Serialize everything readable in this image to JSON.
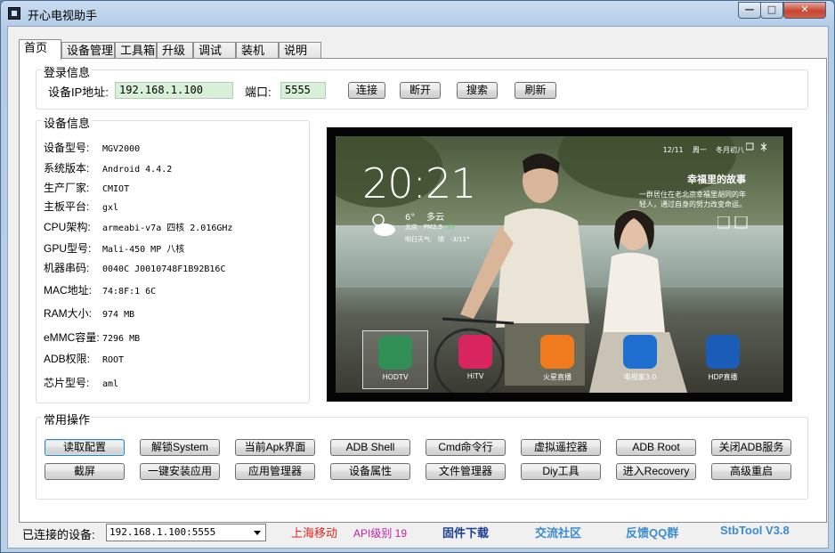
{
  "window": {
    "title": "开心电视助手",
    "controls": {
      "minimize": "—",
      "maximize": "□",
      "close": "✕"
    }
  },
  "tabs": [
    "首页",
    "设备管理",
    "工具箱",
    "升级",
    "调试",
    "装机",
    "说明"
  ],
  "login": {
    "group_label": "登录信息",
    "ip_label": "设备IP地址:",
    "ip_value": "192.168.1.100",
    "port_label": "端口:",
    "port_value": "5555",
    "buttons": [
      "连接",
      "断开",
      "搜索",
      "刷新"
    ]
  },
  "device_info": {
    "group_label": "设备信息",
    "rows": [
      {
        "key": "设备型号:",
        "value": "MGV2000"
      },
      {
        "key": "系统版本:",
        "value": "Android 4.4.2"
      },
      {
        "key": "生产厂家:",
        "value": "CMIOT"
      },
      {
        "key": "主板平台:",
        "value": "gxl"
      },
      {
        "key": "CPU架构:",
        "value": "armeabi-v7a 四核 2.016GHz"
      },
      {
        "key": "GPU型号:",
        "value": "Mali-450 MP 八核"
      },
      {
        "key": "机器串码:",
        "value": "0040C            J0010748F1B92B16C"
      },
      {
        "key": "MAC地址:",
        "value": "74:8F:1        6C"
      },
      {
        "key": "RAM大小:",
        "value": "974 MB"
      },
      {
        "key": "eMMC容量:",
        "value": "7296 MB"
      },
      {
        "key": "ADB权限:",
        "value": "ROOT"
      },
      {
        "key": "芯片型号:",
        "value": "aml"
      }
    ]
  },
  "tv_screen": {
    "top_date": "12/11",
    "top_weekday": "周一",
    "top_lunar": "冬月初八",
    "clock": "20:21",
    "temp": "6°",
    "weather": "多云",
    "city": "北京",
    "pm": "PM2.5",
    "aqi": "59",
    "tomorrow": "明日天气:",
    "tomorrow_weather": "晴",
    "tomorrow_temp": "-3/11°",
    "promo_title": "幸福里的故事",
    "promo_text": "一群居住在老北京幸福里胡同的年轻人，通过自身的努力改变命运。",
    "apps": [
      {
        "name": "HODTV",
        "color": "#2f8f55"
      },
      {
        "name": "HiTV",
        "color": "#d8245f"
      },
      {
        "name": "火星直播",
        "color": "#f07a1e"
      },
      {
        "name": "电视家3.0",
        "color": "#1f6fd0"
      },
      {
        "name": "HDP直播",
        "color": "#1a5db8"
      }
    ]
  },
  "common_ops": {
    "group_label": "常用操作",
    "row1": [
      "读取配置",
      "解锁System",
      "当前Apk界面",
      "ADB Shell",
      "Cmd命令行",
      "虚拟遥控器",
      "ADB  Root",
      "关闭ADB服务"
    ],
    "row2": [
      "截屏",
      "一键安装应用",
      "应用管理器",
      "设备属性",
      "文件管理器",
      "Diy工具",
      "进入Recovery",
      "高级重启"
    ]
  },
  "status_bar": {
    "connected_label": "已连接的设备:",
    "connected_device": "192.168.1.100:5555",
    "carrier": "上海移动",
    "carrier_color": "#e0261b",
    "api_level": "API级别 19",
    "api_color": "#c21fa3",
    "links": [
      {
        "label": "固件下载",
        "color": "#1a3d8f"
      },
      {
        "label": "交流社区",
        "color": "#3b8bd0"
      },
      {
        "label": "反馈QQ群",
        "color": "#3b8bd0"
      },
      {
        "label": "StbTool V3.8",
        "color": "#3b8bd0"
      }
    ]
  }
}
